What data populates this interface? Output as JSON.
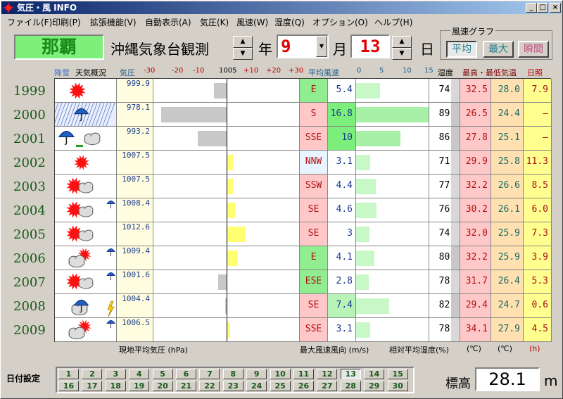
{
  "window": {
    "title": "気圧・風 INFO"
  },
  "menu": [
    "ファイル(F)",
    "印刷(P)",
    "拡張機能(V)",
    "自動表示(A)",
    "気圧(K)",
    "風速(W)",
    "湿度(Q)",
    "オプション(O)",
    "ヘルプ(H)"
  ],
  "toolbar": {
    "station": "那覇",
    "station_name": "沖縄気象台観測",
    "year_label": "年",
    "month_value": "9",
    "month_label": "月",
    "day_value": "13",
    "day_label": "日",
    "wind_graph_label": "風速グラフ",
    "wind_modes": [
      "平均",
      "最大",
      "瞬間"
    ]
  },
  "headers": {
    "kousetsu": "降雪",
    "weather": "天気概況",
    "pressure": "気圧",
    "pressure_scale": [
      "-30",
      "-20",
      "-10",
      "1005",
      "+10",
      "+20",
      "+30"
    ],
    "avg_wind": "平均風速",
    "wind_scale": [
      "0",
      "5",
      "10",
      "15"
    ],
    "humidity": "湿度",
    "temp": "最高・最低気温",
    "sunshine": "日照"
  },
  "rows": [
    {
      "year": "1999",
      "pressure": "999.9",
      "dir": "E",
      "wind": "5.4",
      "hum": "74",
      "tmax": "32.5",
      "tmin": "28.0",
      "sun": "7.9",
      "weather": "sun",
      "umbrella": false,
      "dirbg": "#90ee90",
      "windbg": "#fff"
    },
    {
      "year": "2000",
      "pressure": "978.1",
      "dir": "S",
      "wind": "16.8",
      "hum": "89",
      "tmax": "26.5",
      "tmin": "24.4",
      "sun": "—",
      "weather": "rain",
      "umbrella": false,
      "dirbg": "#ffc8c8",
      "windbg": "#7cee7c"
    },
    {
      "year": "2001",
      "pressure": "993.2",
      "dir": "SSE",
      "wind": "10",
      "hum": "86",
      "tmax": "27.8",
      "tmin": "25.1",
      "sun": "—",
      "weather": "umbrella-cloud",
      "umbrella": false,
      "dirbg": "#ffc8c8",
      "windbg": "#7cee7c"
    },
    {
      "year": "2002",
      "pressure": "1007.5",
      "dir": "NNW",
      "wind": "3.1",
      "hum": "71",
      "tmax": "29.9",
      "tmin": "25.8",
      "sun": "11.3",
      "weather": "sun-small",
      "umbrella": false,
      "dirbg": "#e8f4ff",
      "windbg": "#fff"
    },
    {
      "year": "2003",
      "pressure": "1007.5",
      "dir": "SSW",
      "wind": "4.4",
      "hum": "77",
      "tmax": "32.2",
      "tmin": "26.6",
      "sun": "8.5",
      "weather": "sun-cloud",
      "umbrella": false,
      "dirbg": "#ffc8c8",
      "windbg": "#fff"
    },
    {
      "year": "2004",
      "pressure": "1008.4",
      "dir": "SE",
      "wind": "4.6",
      "hum": "76",
      "tmax": "30.2",
      "tmin": "26.1",
      "sun": "6.0",
      "weather": "sun-cloud",
      "umbrella": true,
      "dirbg": "#ffc8c8",
      "windbg": "#fff"
    },
    {
      "year": "2005",
      "pressure": "1012.6",
      "dir": "SE",
      "wind": "3",
      "hum": "74",
      "tmax": "32.0",
      "tmin": "25.9",
      "sun": "7.3",
      "weather": "sun-cloud",
      "umbrella": false,
      "dirbg": "#ffc8c8",
      "windbg": "#fff"
    },
    {
      "year": "2006",
      "pressure": "1009.4",
      "dir": "E",
      "wind": "4.1",
      "hum": "80",
      "tmax": "32.2",
      "tmin": "25.9",
      "sun": "3.9",
      "weather": "cloud-sun",
      "umbrella": true,
      "dirbg": "#90ee90",
      "windbg": "#fff"
    },
    {
      "year": "2007",
      "pressure": "1001.6",
      "dir": "ESE",
      "wind": "2.8",
      "hum": "78",
      "tmax": "31.7",
      "tmin": "26.4",
      "sun": "5.3",
      "weather": "sun-cloud",
      "umbrella": true,
      "dirbg": "#90ee90",
      "windbg": "#fff"
    },
    {
      "year": "2008",
      "pressure": "1004.4",
      "dir": "SE",
      "wind": "7.4",
      "hum": "82",
      "tmax": "29.4",
      "tmin": "24.7",
      "sun": "0.6",
      "weather": "rain-cloud",
      "umbrella": false,
      "dirbg": "#ffc8c8",
      "windbg": "#b8f4b8"
    },
    {
      "year": "2009",
      "pressure": "1006.5",
      "dir": "SSE",
      "wind": "3.1",
      "hum": "78",
      "tmax": "34.1",
      "tmin": "27.9",
      "sun": "4.5",
      "weather": "cloud-sun",
      "umbrella": true,
      "dirbg": "#ffc8c8",
      "windbg": "#fff"
    }
  ],
  "footer": {
    "pressure": "現地平均気圧 (hPa)",
    "wind": "最大風速風向 (m/s)",
    "hum": "相対平均湿度(%)",
    "tmax_unit": "(℃)",
    "tmin_unit": "(℃)",
    "sun_unit": "(h)"
  },
  "date_setting": "日付設定",
  "days": [
    "1",
    "2",
    "3",
    "4",
    "5",
    "6",
    "7",
    "8",
    "9",
    "10",
    "11",
    "12",
    "13",
    "14",
    "15",
    "16",
    "17",
    "18",
    "19",
    "20",
    "21",
    "22",
    "23",
    "24",
    "25",
    "26",
    "27",
    "28",
    "29",
    "30"
  ],
  "selected_day": "13",
  "altitude_label": "標高",
  "altitude_value": "28.1",
  "altitude_unit": "m"
}
